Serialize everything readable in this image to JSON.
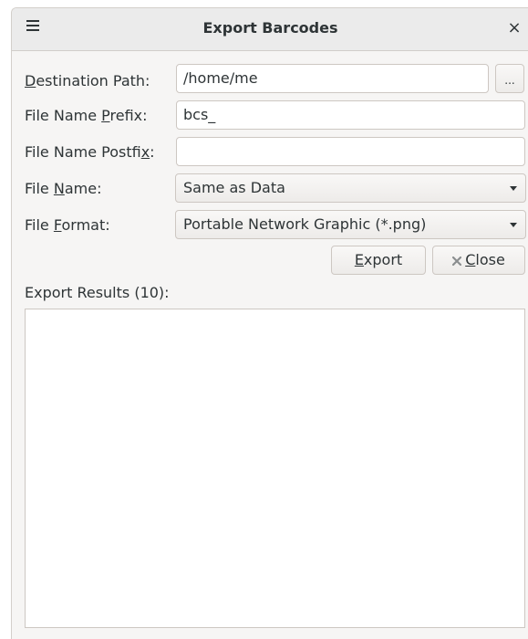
{
  "window": {
    "title": "Export Barcodes"
  },
  "form": {
    "destination_label": {
      "pre": "",
      "key": "D",
      "post": "estination Path:"
    },
    "destination_value": "/home/me",
    "browse_label": "...",
    "prefix_label": {
      "pre": "File Name ",
      "key": "P",
      "post": "refix:"
    },
    "prefix_value": "bcs_",
    "postfix_label": {
      "pre": "File Name Postfi",
      "key": "x",
      "post": ":"
    },
    "postfix_value": "",
    "filename_label": {
      "pre": "File ",
      "key": "N",
      "post": "ame:"
    },
    "filename_selected": "Same as Data",
    "format_label": {
      "pre": "File ",
      "key": "F",
      "post": "ormat:"
    },
    "format_selected": "Portable Network Graphic (*.png)"
  },
  "buttons": {
    "export": {
      "pre": "",
      "key": "E",
      "post": "xport"
    },
    "close": {
      "pre": "",
      "key": "C",
      "post": "lose"
    }
  },
  "results": {
    "label": "Export Results (10):",
    "items": []
  }
}
